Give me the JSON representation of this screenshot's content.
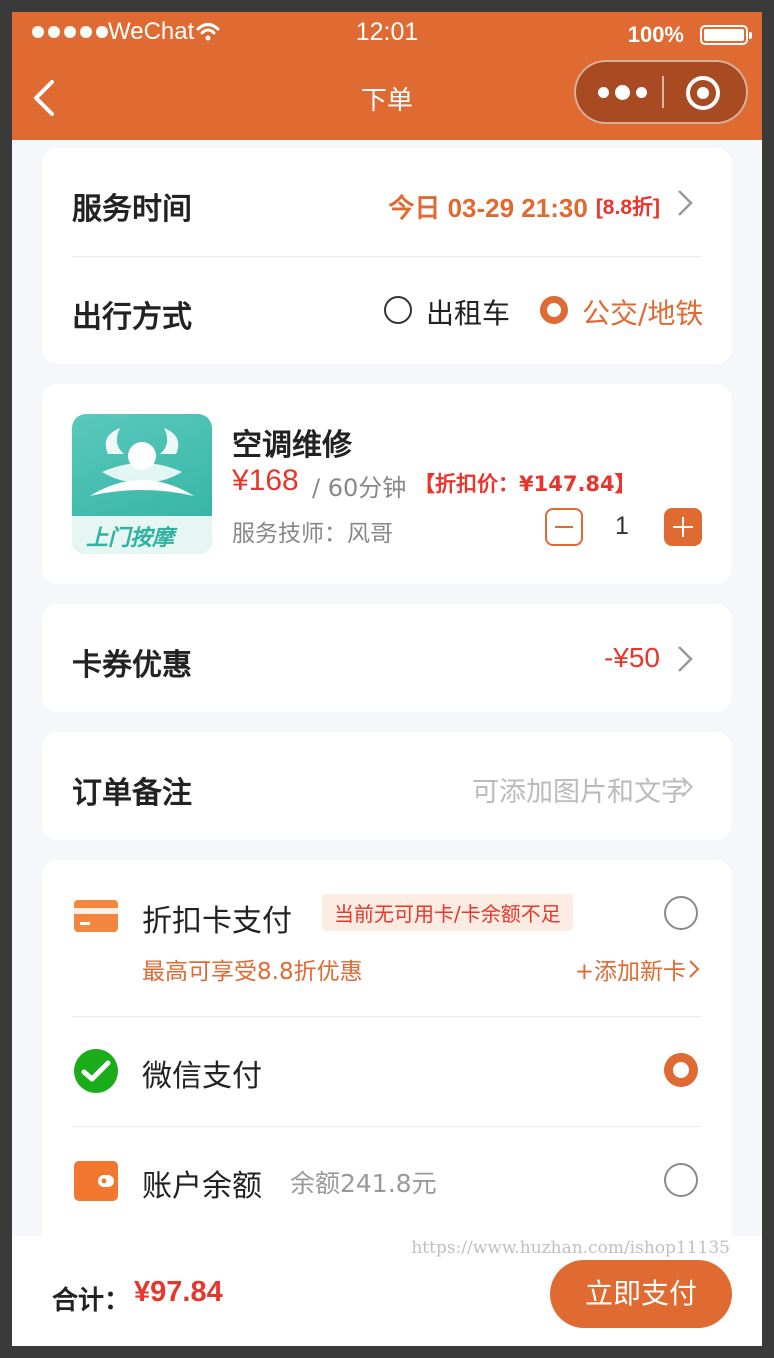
{
  "status_bar": {
    "carrier": "WeChat",
    "time": "12:01",
    "battery": "100%"
  },
  "nav": {
    "title": "下单"
  },
  "service_time": {
    "label": "服务时间",
    "value": "今日 03-29 21:30",
    "discount": "[8.8折]"
  },
  "travel": {
    "label": "出行方式",
    "options": [
      {
        "label": "出租车",
        "selected": false
      },
      {
        "label": "公交/地铁",
        "selected": true
      }
    ]
  },
  "product": {
    "image_text": "上门按摩",
    "name": "空调维修",
    "price": "¥168",
    "duration": "/ 60分钟",
    "discount_price": "【折扣价：¥147.84】",
    "technician": "服务技师：风哥",
    "quantity": "1"
  },
  "coupon": {
    "label": "卡券优惠",
    "value": "-¥50"
  },
  "remark": {
    "label": "订单备注",
    "placeholder": "可添加图片和文字"
  },
  "payment": {
    "methods": [
      {
        "label": "折扣卡支付",
        "note": "当前无可用卡/卡余额不足",
        "sub": "最高可享受8.8折优惠",
        "action": "+添加新卡",
        "selected": false
      },
      {
        "label": "微信支付",
        "selected": true
      },
      {
        "label": "账户余额",
        "balance": "余额241.8元",
        "selected": false
      }
    ]
  },
  "footer": {
    "total_label": "合计：",
    "total_value": "¥97.84",
    "pay_button": "立即支付"
  },
  "watermark": "https://www.huzhan.com/ishop11135",
  "colors": {
    "brand": "#df6a32",
    "price_red": "#e7362b",
    "wechat_green": "#1aad19",
    "background": "#f6f7fb"
  },
  "icons": [
    "back-icon",
    "more-icon",
    "close-icon",
    "chevron-right-icon",
    "card-icon",
    "wechat-pay-icon",
    "wallet-icon",
    "minus-icon",
    "plus-icon"
  ]
}
